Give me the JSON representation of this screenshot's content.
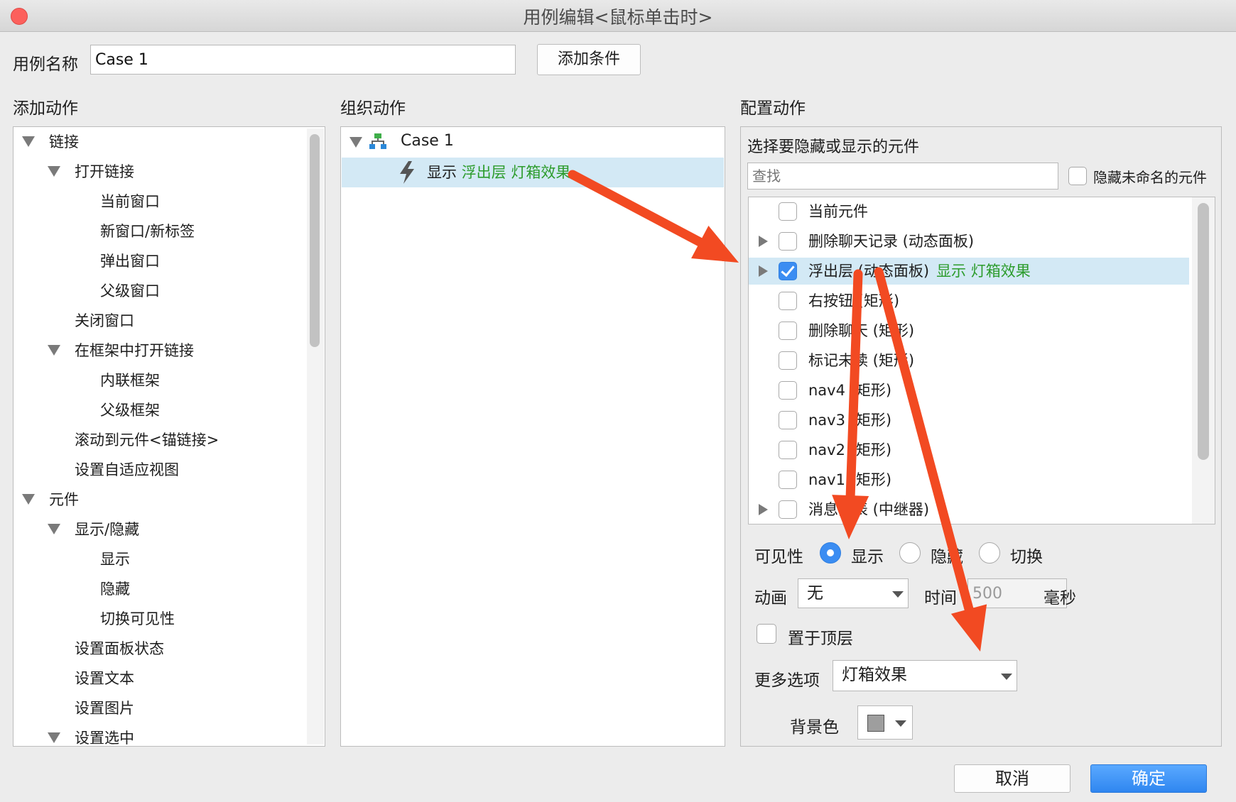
{
  "window": {
    "title": "用例编辑<鼠标单击时>"
  },
  "case_name": {
    "label": "用例名称",
    "value": "Case 1",
    "add_condition_button": "添加条件"
  },
  "add_actions": {
    "heading": "添加动作",
    "items": [
      {
        "label": "链接",
        "level": 0,
        "expanded": true
      },
      {
        "label": "打开链接",
        "level": 1,
        "expanded": true
      },
      {
        "label": "当前窗口",
        "level": 2
      },
      {
        "label": "新窗口/新标签",
        "level": 2
      },
      {
        "label": "弹出窗口",
        "level": 2
      },
      {
        "label": "父级窗口",
        "level": 2
      },
      {
        "label": "关闭窗口",
        "level": 1
      },
      {
        "label": "在框架中打开链接",
        "level": 1,
        "expanded": true
      },
      {
        "label": "内联框架",
        "level": 2
      },
      {
        "label": "父级框架",
        "level": 2
      },
      {
        "label": "滚动到元件<锚链接>",
        "level": 1
      },
      {
        "label": "设置自适应视图",
        "level": 1
      },
      {
        "label": "元件",
        "level": 0,
        "expanded": true
      },
      {
        "label": "显示/隐藏",
        "level": 1,
        "expanded": true
      },
      {
        "label": "显示",
        "level": 2
      },
      {
        "label": "隐藏",
        "level": 2
      },
      {
        "label": "切换可见性",
        "level": 2
      },
      {
        "label": "设置面板状态",
        "level": 1
      },
      {
        "label": "设置文本",
        "level": 1
      },
      {
        "label": "设置图片",
        "level": 1
      },
      {
        "label": "设置选中",
        "level": 1,
        "expanded": true
      }
    ]
  },
  "organize_actions": {
    "heading": "组织动作",
    "case_label": "Case 1",
    "action": {
      "verb": "显示",
      "detail": "浮出层 灯箱效果"
    }
  },
  "configure_actions": {
    "heading": "配置动作",
    "subheading": "选择要隐藏或显示的元件",
    "search_placeholder": "查找",
    "hide_unnamed_label": "隐藏未命名的元件",
    "components": [
      {
        "name": "当前元件",
        "checked": false,
        "expandable": false,
        "note": ""
      },
      {
        "name": "删除聊天记录 (动态面板)",
        "checked": false,
        "expandable": true,
        "note": ""
      },
      {
        "name": "浮出层 (动态面板)",
        "checked": true,
        "expandable": true,
        "note": "显示 灯箱效果"
      },
      {
        "name": "右按钮 (矩形)",
        "checked": false,
        "expandable": false,
        "note": ""
      },
      {
        "name": "删除聊天 (矩形)",
        "checked": false,
        "expandable": false,
        "note": ""
      },
      {
        "name": "标记未读 (矩形)",
        "checked": false,
        "expandable": false,
        "note": ""
      },
      {
        "name": "nav4 (矩形)",
        "checked": false,
        "expandable": false,
        "note": ""
      },
      {
        "name": "nav3 (矩形)",
        "checked": false,
        "expandable": false,
        "note": ""
      },
      {
        "name": "nav2 (矩形)",
        "checked": false,
        "expandable": false,
        "note": ""
      },
      {
        "name": "nav1 (矩形)",
        "checked": false,
        "expandable": false,
        "note": ""
      },
      {
        "name": "消息列表 (中继器)",
        "checked": false,
        "expandable": true,
        "note": ""
      }
    ],
    "visibility": {
      "label": "可见性",
      "options": [
        "显示",
        "隐藏",
        "切换"
      ],
      "selected": "显示"
    },
    "animation": {
      "label": "动画",
      "value": "无",
      "time_label": "时间",
      "time_value": "500",
      "unit": "毫秒"
    },
    "bring_to_front_label": "置于顶层",
    "more_options": {
      "label": "更多选项",
      "value": "灯箱效果"
    },
    "background": {
      "label": "背景色",
      "swatch": "#9e9e9e"
    }
  },
  "footer": {
    "cancel": "取消",
    "ok": "确定"
  },
  "colors": {
    "accent": "#3b8df2",
    "selection": "#d3e9f5",
    "note_green": "#2c9c2c",
    "arrow": "#f24a22"
  }
}
